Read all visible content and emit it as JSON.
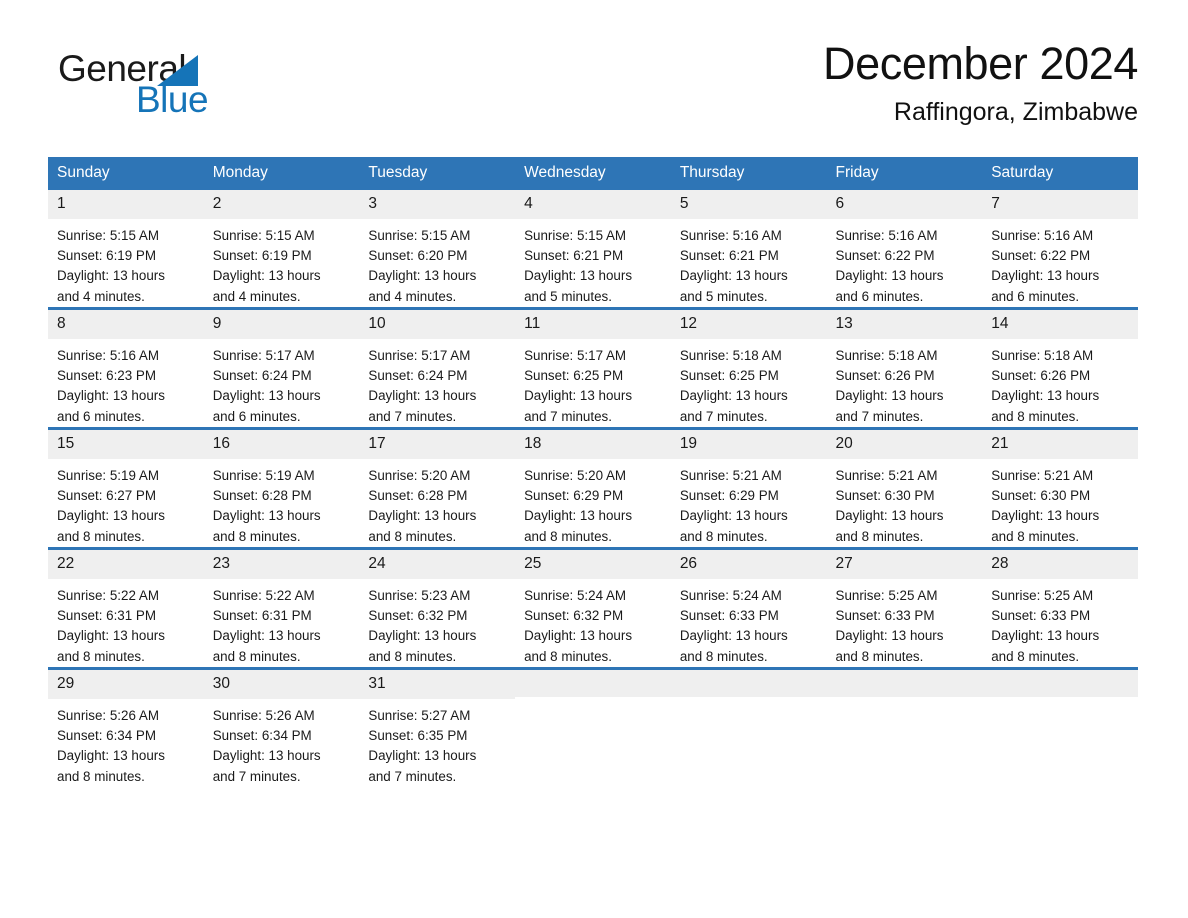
{
  "logo": {
    "word_one": "General",
    "word_two": "Blue",
    "accent_color": "#1574b8"
  },
  "header": {
    "title": "December 2024",
    "subtitle": "Raffingora, Zimbabwe"
  },
  "theme": {
    "header_blue": "#2e75b6",
    "day_band_gray": "#efefef",
    "text_color": "#1a1a1a"
  },
  "weekday_headers": [
    "Sunday",
    "Monday",
    "Tuesday",
    "Wednesday",
    "Thursday",
    "Friday",
    "Saturday"
  ],
  "weeks": [
    [
      {
        "day": "1",
        "sunrise": "Sunrise: 5:15 AM",
        "sunset": "Sunset: 6:19 PM",
        "daylight_line1": "Daylight: 13 hours",
        "daylight_line2": "and 4 minutes."
      },
      {
        "day": "2",
        "sunrise": "Sunrise: 5:15 AM",
        "sunset": "Sunset: 6:19 PM",
        "daylight_line1": "Daylight: 13 hours",
        "daylight_line2": "and 4 minutes."
      },
      {
        "day": "3",
        "sunrise": "Sunrise: 5:15 AM",
        "sunset": "Sunset: 6:20 PM",
        "daylight_line1": "Daylight: 13 hours",
        "daylight_line2": "and 4 minutes."
      },
      {
        "day": "4",
        "sunrise": "Sunrise: 5:15 AM",
        "sunset": "Sunset: 6:21 PM",
        "daylight_line1": "Daylight: 13 hours",
        "daylight_line2": "and 5 minutes."
      },
      {
        "day": "5",
        "sunrise": "Sunrise: 5:16 AM",
        "sunset": "Sunset: 6:21 PM",
        "daylight_line1": "Daylight: 13 hours",
        "daylight_line2": "and 5 minutes."
      },
      {
        "day": "6",
        "sunrise": "Sunrise: 5:16 AM",
        "sunset": "Sunset: 6:22 PM",
        "daylight_line1": "Daylight: 13 hours",
        "daylight_line2": "and 6 minutes."
      },
      {
        "day": "7",
        "sunrise": "Sunrise: 5:16 AM",
        "sunset": "Sunset: 6:22 PM",
        "daylight_line1": "Daylight: 13 hours",
        "daylight_line2": "and 6 minutes."
      }
    ],
    [
      {
        "day": "8",
        "sunrise": "Sunrise: 5:16 AM",
        "sunset": "Sunset: 6:23 PM",
        "daylight_line1": "Daylight: 13 hours",
        "daylight_line2": "and 6 minutes."
      },
      {
        "day": "9",
        "sunrise": "Sunrise: 5:17 AM",
        "sunset": "Sunset: 6:24 PM",
        "daylight_line1": "Daylight: 13 hours",
        "daylight_line2": "and 6 minutes."
      },
      {
        "day": "10",
        "sunrise": "Sunrise: 5:17 AM",
        "sunset": "Sunset: 6:24 PM",
        "daylight_line1": "Daylight: 13 hours",
        "daylight_line2": "and 7 minutes."
      },
      {
        "day": "11",
        "sunrise": "Sunrise: 5:17 AM",
        "sunset": "Sunset: 6:25 PM",
        "daylight_line1": "Daylight: 13 hours",
        "daylight_line2": "and 7 minutes."
      },
      {
        "day": "12",
        "sunrise": "Sunrise: 5:18 AM",
        "sunset": "Sunset: 6:25 PM",
        "daylight_line1": "Daylight: 13 hours",
        "daylight_line2": "and 7 minutes."
      },
      {
        "day": "13",
        "sunrise": "Sunrise: 5:18 AM",
        "sunset": "Sunset: 6:26 PM",
        "daylight_line1": "Daylight: 13 hours",
        "daylight_line2": "and 7 minutes."
      },
      {
        "day": "14",
        "sunrise": "Sunrise: 5:18 AM",
        "sunset": "Sunset: 6:26 PM",
        "daylight_line1": "Daylight: 13 hours",
        "daylight_line2": "and 8 minutes."
      }
    ],
    [
      {
        "day": "15",
        "sunrise": "Sunrise: 5:19 AM",
        "sunset": "Sunset: 6:27 PM",
        "daylight_line1": "Daylight: 13 hours",
        "daylight_line2": "and 8 minutes."
      },
      {
        "day": "16",
        "sunrise": "Sunrise: 5:19 AM",
        "sunset": "Sunset: 6:28 PM",
        "daylight_line1": "Daylight: 13 hours",
        "daylight_line2": "and 8 minutes."
      },
      {
        "day": "17",
        "sunrise": "Sunrise: 5:20 AM",
        "sunset": "Sunset: 6:28 PM",
        "daylight_line1": "Daylight: 13 hours",
        "daylight_line2": "and 8 minutes."
      },
      {
        "day": "18",
        "sunrise": "Sunrise: 5:20 AM",
        "sunset": "Sunset: 6:29 PM",
        "daylight_line1": "Daylight: 13 hours",
        "daylight_line2": "and 8 minutes."
      },
      {
        "day": "19",
        "sunrise": "Sunrise: 5:21 AM",
        "sunset": "Sunset: 6:29 PM",
        "daylight_line1": "Daylight: 13 hours",
        "daylight_line2": "and 8 minutes."
      },
      {
        "day": "20",
        "sunrise": "Sunrise: 5:21 AM",
        "sunset": "Sunset: 6:30 PM",
        "daylight_line1": "Daylight: 13 hours",
        "daylight_line2": "and 8 minutes."
      },
      {
        "day": "21",
        "sunrise": "Sunrise: 5:21 AM",
        "sunset": "Sunset: 6:30 PM",
        "daylight_line1": "Daylight: 13 hours",
        "daylight_line2": "and 8 minutes."
      }
    ],
    [
      {
        "day": "22",
        "sunrise": "Sunrise: 5:22 AM",
        "sunset": "Sunset: 6:31 PM",
        "daylight_line1": "Daylight: 13 hours",
        "daylight_line2": "and 8 minutes."
      },
      {
        "day": "23",
        "sunrise": "Sunrise: 5:22 AM",
        "sunset": "Sunset: 6:31 PM",
        "daylight_line1": "Daylight: 13 hours",
        "daylight_line2": "and 8 minutes."
      },
      {
        "day": "24",
        "sunrise": "Sunrise: 5:23 AM",
        "sunset": "Sunset: 6:32 PM",
        "daylight_line1": "Daylight: 13 hours",
        "daylight_line2": "and 8 minutes."
      },
      {
        "day": "25",
        "sunrise": "Sunrise: 5:24 AM",
        "sunset": "Sunset: 6:32 PM",
        "daylight_line1": "Daylight: 13 hours",
        "daylight_line2": "and 8 minutes."
      },
      {
        "day": "26",
        "sunrise": "Sunrise: 5:24 AM",
        "sunset": "Sunset: 6:33 PM",
        "daylight_line1": "Daylight: 13 hours",
        "daylight_line2": "and 8 minutes."
      },
      {
        "day": "27",
        "sunrise": "Sunrise: 5:25 AM",
        "sunset": "Sunset: 6:33 PM",
        "daylight_line1": "Daylight: 13 hours",
        "daylight_line2": "and 8 minutes."
      },
      {
        "day": "28",
        "sunrise": "Sunrise: 5:25 AM",
        "sunset": "Sunset: 6:33 PM",
        "daylight_line1": "Daylight: 13 hours",
        "daylight_line2": "and 8 minutes."
      }
    ],
    [
      {
        "day": "29",
        "sunrise": "Sunrise: 5:26 AM",
        "sunset": "Sunset: 6:34 PM",
        "daylight_line1": "Daylight: 13 hours",
        "daylight_line2": "and 8 minutes."
      },
      {
        "day": "30",
        "sunrise": "Sunrise: 5:26 AM",
        "sunset": "Sunset: 6:34 PM",
        "daylight_line1": "Daylight: 13 hours",
        "daylight_line2": "and 7 minutes."
      },
      {
        "day": "31",
        "sunrise": "Sunrise: 5:27 AM",
        "sunset": "Sunset: 6:35 PM",
        "daylight_line1": "Daylight: 13 hours",
        "daylight_line2": "and 7 minutes."
      },
      {
        "day": "",
        "sunrise": "",
        "sunset": "",
        "daylight_line1": "",
        "daylight_line2": ""
      },
      {
        "day": "",
        "sunrise": "",
        "sunset": "",
        "daylight_line1": "",
        "daylight_line2": ""
      },
      {
        "day": "",
        "sunrise": "",
        "sunset": "",
        "daylight_line1": "",
        "daylight_line2": ""
      },
      {
        "day": "",
        "sunrise": "",
        "sunset": "",
        "daylight_line1": "",
        "daylight_line2": ""
      }
    ]
  ]
}
